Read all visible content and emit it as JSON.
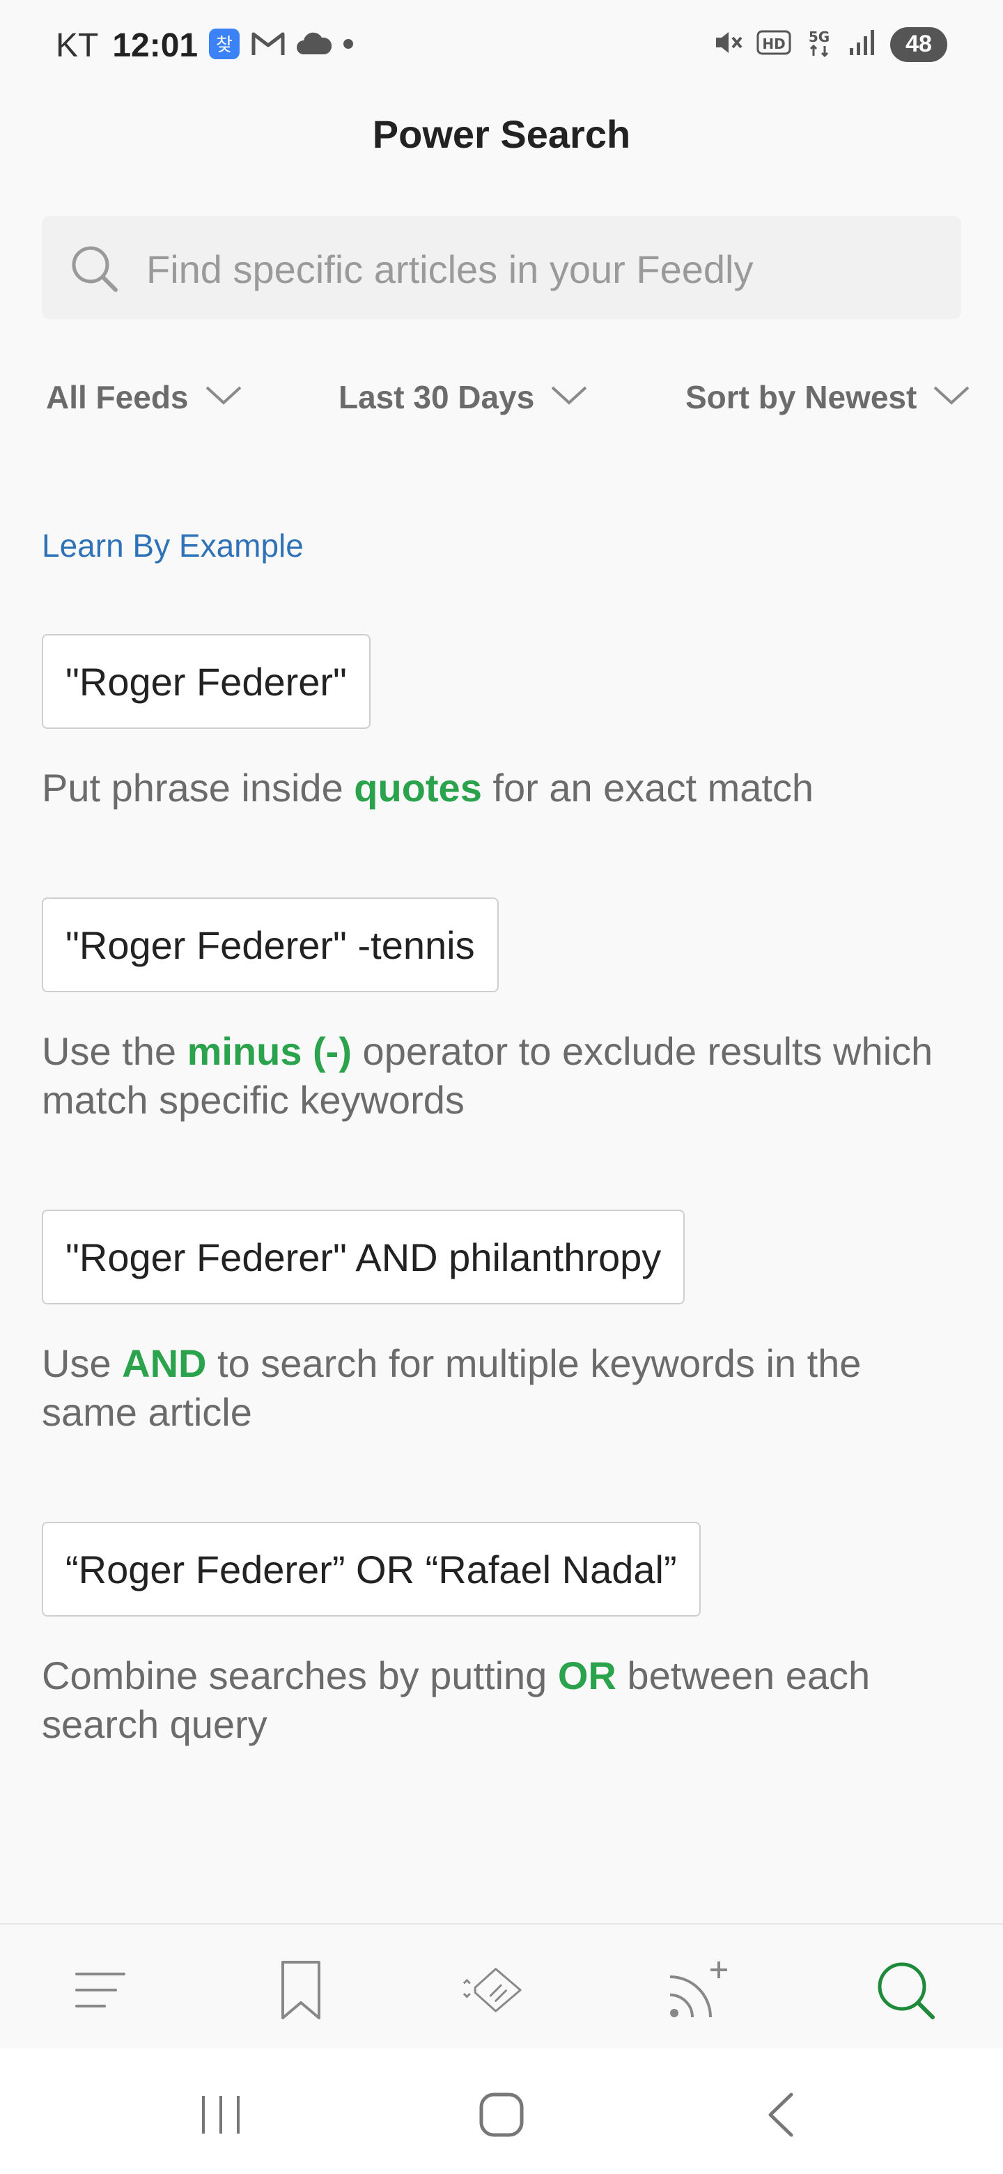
{
  "status_bar": {
    "carrier": "KT",
    "time": "12:01",
    "battery": "48"
  },
  "header": {
    "title": "Power Search"
  },
  "search": {
    "placeholder": "Find specific articles in your Feedly"
  },
  "filters": {
    "feeds": "All Feeds",
    "range": "Last 30 Days",
    "sort": "Sort by Newest"
  },
  "learn_link": "Learn By Example",
  "examples": [
    {
      "query": "\"Roger Federer\"",
      "desc_before": "Put phrase inside ",
      "desc_highlight": "quotes",
      "desc_after": " for an exact match"
    },
    {
      "query": "\"Roger Federer\" -tennis",
      "desc_before": "Use the ",
      "desc_highlight": "minus (-)",
      "desc_after": " operator to exclude results which match specific keywords"
    },
    {
      "query": "\"Roger Federer\" AND philanthropy",
      "desc_before": "Use ",
      "desc_highlight": "AND",
      "desc_after": " to search for multiple keywords in the same article"
    },
    {
      "query": "“Roger Federer” OR “Rafael Nadal”",
      "desc_before": "Combine searches by putting ",
      "desc_highlight": "OR",
      "desc_after": " between each search query"
    }
  ],
  "colors": {
    "accent_green": "#2ba24c",
    "link_blue": "#2f72b8",
    "active_nav": "#1f8a3a"
  },
  "bottom_nav_icons": [
    "menu-icon",
    "bookmark-icon",
    "feedly-icon",
    "add-feed-icon",
    "search-icon"
  ],
  "system_nav_icons": [
    "recents-icon",
    "home-icon",
    "back-icon"
  ]
}
